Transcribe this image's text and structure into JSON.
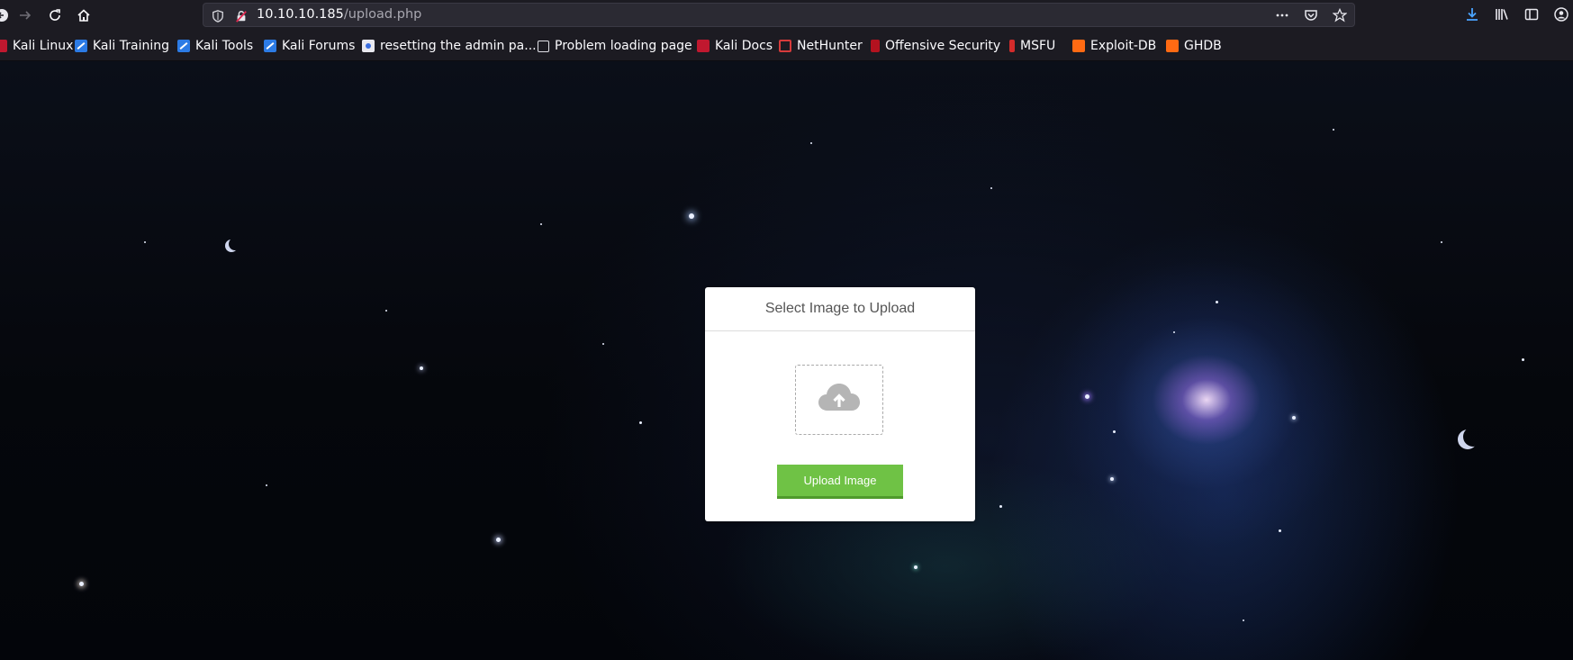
{
  "browser": {
    "url_host": "10.10.10.185",
    "url_path": "/upload.php"
  },
  "bookmarks": [
    {
      "label": "Kali Linux",
      "icon": "kali-dragon-icon"
    },
    {
      "label": "Kali Training",
      "icon": "kali-dragon-icon"
    },
    {
      "label": "Kali Tools",
      "icon": "kali-dragon-icon"
    },
    {
      "label": "Kali Forums",
      "icon": "kali-dragon-icon"
    },
    {
      "label": "resetting the admin pa...",
      "icon": "blue-circle-icon"
    },
    {
      "label": "Problem loading page",
      "icon": "globe-icon"
    },
    {
      "label": "Kali Docs",
      "icon": "kali-docs-icon"
    },
    {
      "label": "NetHunter",
      "icon": "nethunter-icon"
    },
    {
      "label": "Offensive Security",
      "icon": "offsec-icon"
    },
    {
      "label": "MSFU",
      "icon": "msfu-icon"
    },
    {
      "label": "Exploit-DB",
      "icon": "exploitdb-icon"
    },
    {
      "label": "GHDB",
      "icon": "ghdb-icon"
    }
  ],
  "upload_card": {
    "title": "Select Image to Upload",
    "button_label": "Upload Image",
    "dropzone_icon": "cloud-upload-icon"
  },
  "colors": {
    "button": "#6fc245",
    "browser_chrome": "#1c1b22",
    "urlbar": "#2b2a33"
  }
}
